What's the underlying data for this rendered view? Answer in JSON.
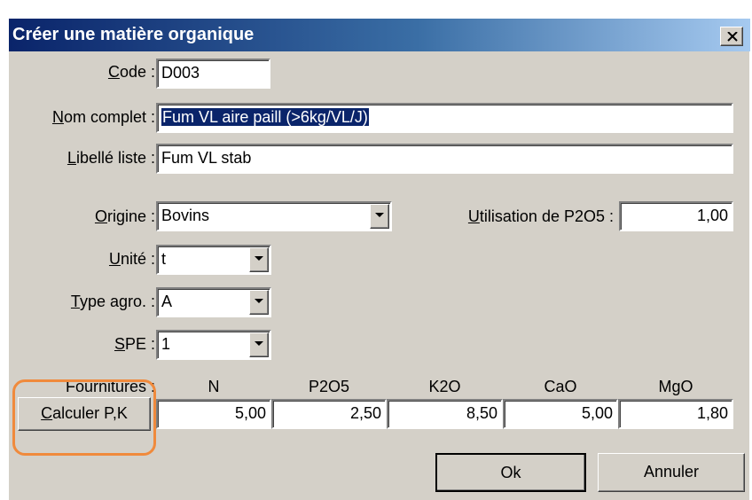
{
  "window": {
    "title": "Créer une matière organique",
    "close_icon": "close-icon"
  },
  "labels": {
    "code": {
      "acc": "C",
      "rest": "ode :"
    },
    "nom_complet": {
      "acc": "N",
      "rest": "om complet :"
    },
    "libelle_liste": {
      "pre": "",
      "acc": "L",
      "rest": "ibellé liste :"
    },
    "origine": {
      "acc": "O",
      "rest": "rigine :"
    },
    "unite": {
      "acc": "U",
      "rest": "nité :"
    },
    "type_agro": {
      "acc": "T",
      "rest": "ype agro. :"
    },
    "spe": {
      "acc": "S",
      "rest": "PE :"
    },
    "utilisation": {
      "acc": "U",
      "rest": "tilisation de P2O5 :"
    },
    "fournitures": "Fournitures :"
  },
  "fields": {
    "code": "D003",
    "nom_complet": "Fum VL aire paill (>6kg/VL/J)",
    "libelle_liste": "Fum VL stab",
    "utilisation_p2o5": "1,00"
  },
  "selects": {
    "origine": "Bovins",
    "unite": "t",
    "type_agro": "A",
    "spe": "1"
  },
  "nutrients": {
    "headers": [
      "N",
      "P2O5",
      "K2O",
      "CaO",
      "MgO"
    ],
    "values": [
      "5,00",
      "2,50",
      "8,50",
      "5,00",
      "1,80"
    ]
  },
  "buttons": {
    "calculer": {
      "acc": "C",
      "rest": "alculer P,K"
    },
    "ok": "Ok",
    "annuler": "Annuler"
  },
  "colors": {
    "titlebar_start": "#0a246a",
    "titlebar_end": "#a6caf0",
    "highlight": "#f08a3c",
    "dialog_bg": "#d4d0c8"
  }
}
